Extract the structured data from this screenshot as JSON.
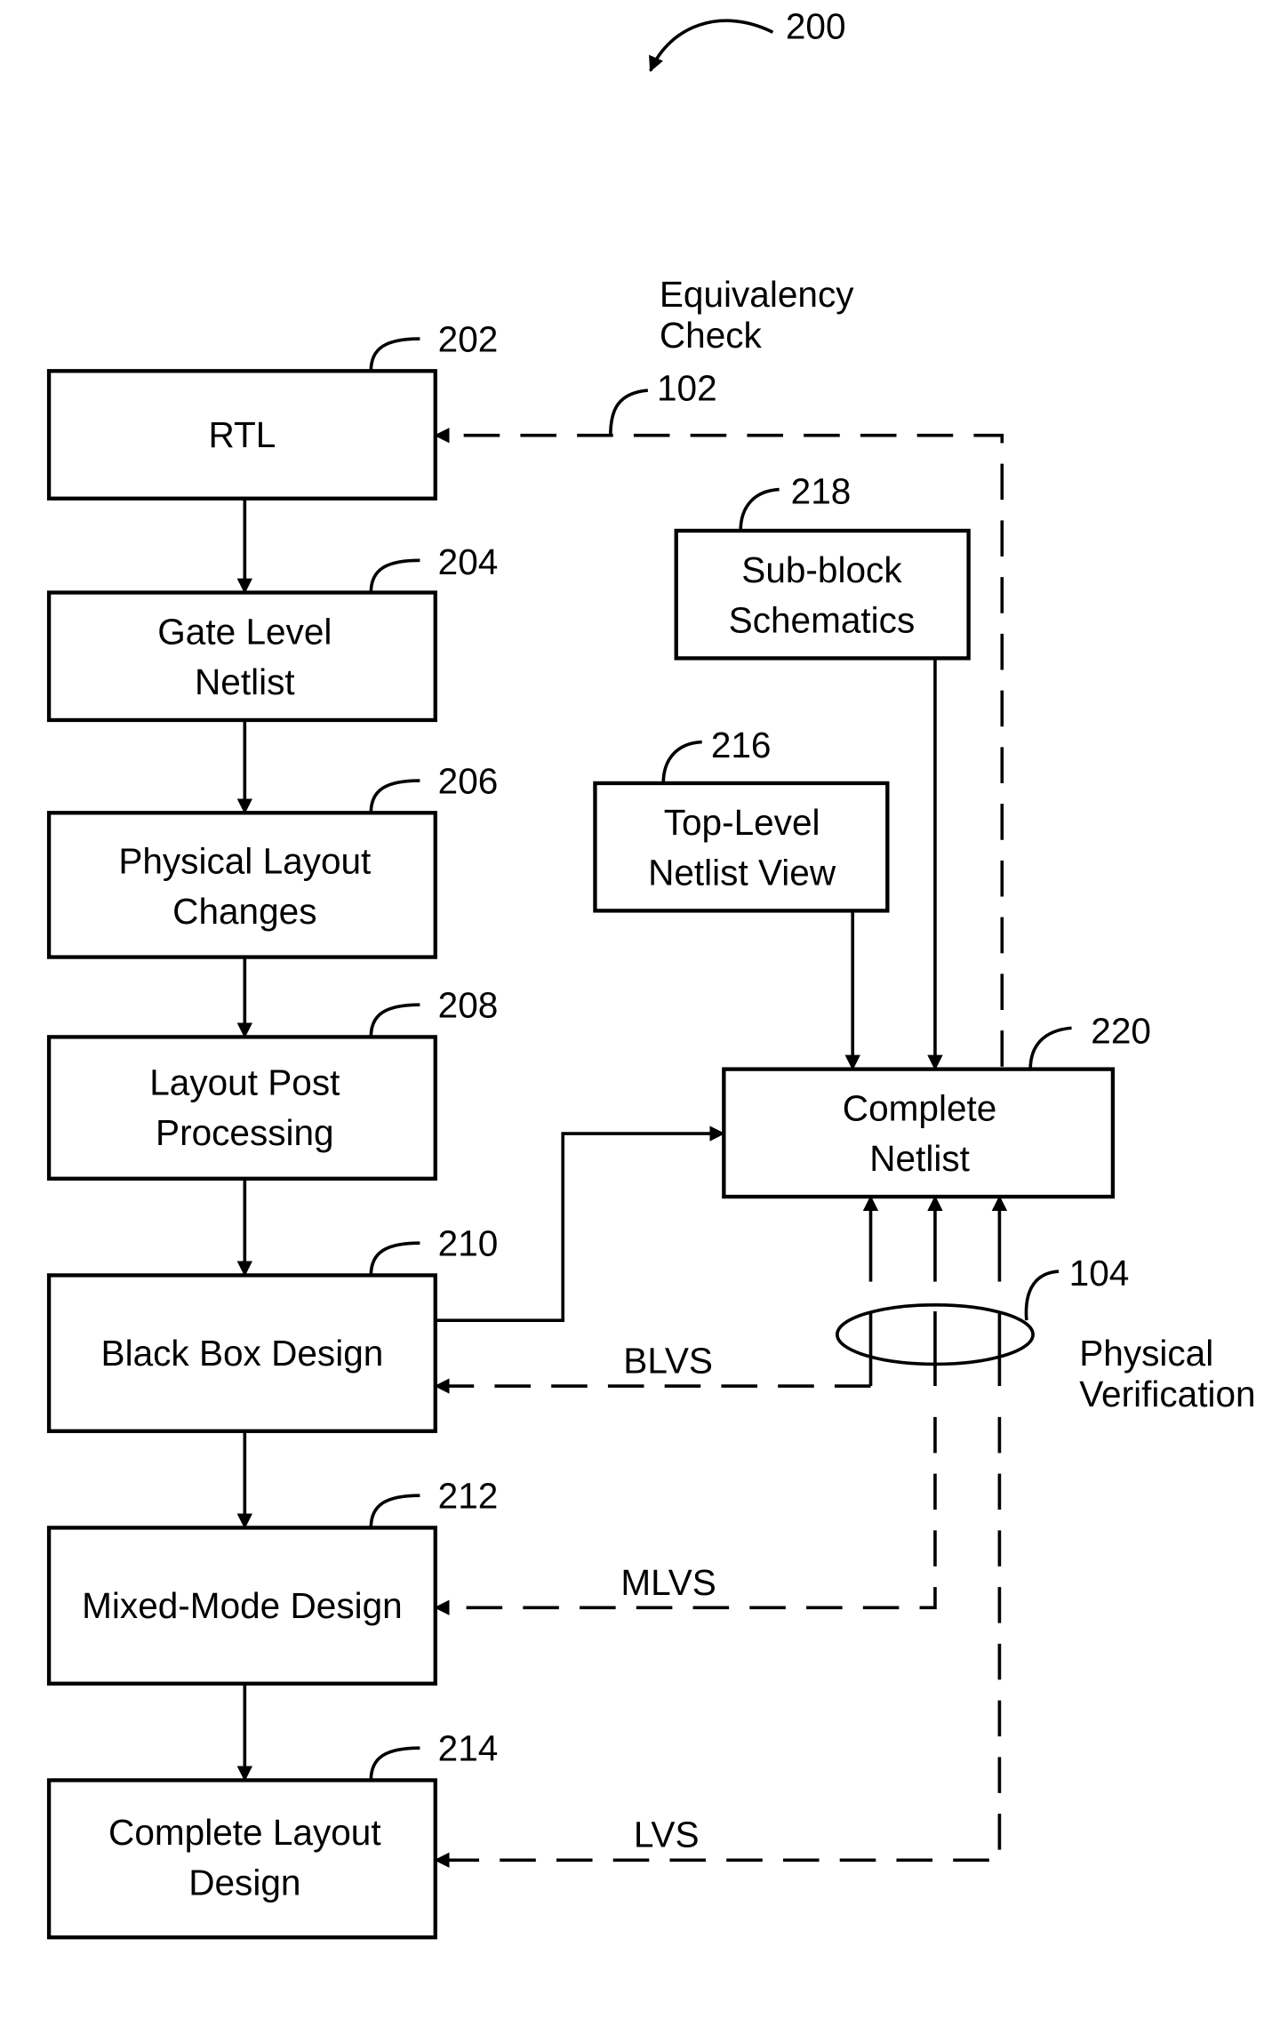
{
  "figure": {
    "ref": "200",
    "steps": [
      {
        "ref": "202",
        "lines": [
          "RTL"
        ]
      },
      {
        "ref": "204",
        "lines": [
          "Gate Level",
          "Netlist"
        ]
      },
      {
        "ref": "206",
        "lines": [
          "Physical Layout",
          "Changes"
        ]
      },
      {
        "ref": "208",
        "lines": [
          "Layout Post",
          "Processing"
        ]
      },
      {
        "ref": "210",
        "lines": [
          "Black Box Design"
        ]
      },
      {
        "ref": "212",
        "lines": [
          "Mixed-Mode Design"
        ]
      },
      {
        "ref": "214",
        "lines": [
          "Complete Layout",
          "Design"
        ]
      }
    ],
    "sub_block": {
      "ref": "218",
      "lines": [
        "Sub-block",
        "Schematics"
      ]
    },
    "top_level": {
      "ref": "216",
      "lines": [
        "Top-Level",
        "Netlist View"
      ]
    },
    "complete_netlist": {
      "ref": "220",
      "lines": [
        "Complete",
        "Netlist"
      ]
    },
    "equivalency": {
      "ref": "102",
      "lines": [
        "Equivalency",
        "Check"
      ]
    },
    "physical_verification": {
      "ref": "104",
      "lines": [
        "Physical",
        "Verification"
      ]
    },
    "checks": {
      "blvs": "BLVS",
      "mlvs": "MLVS",
      "lvs": "LVS"
    }
  }
}
